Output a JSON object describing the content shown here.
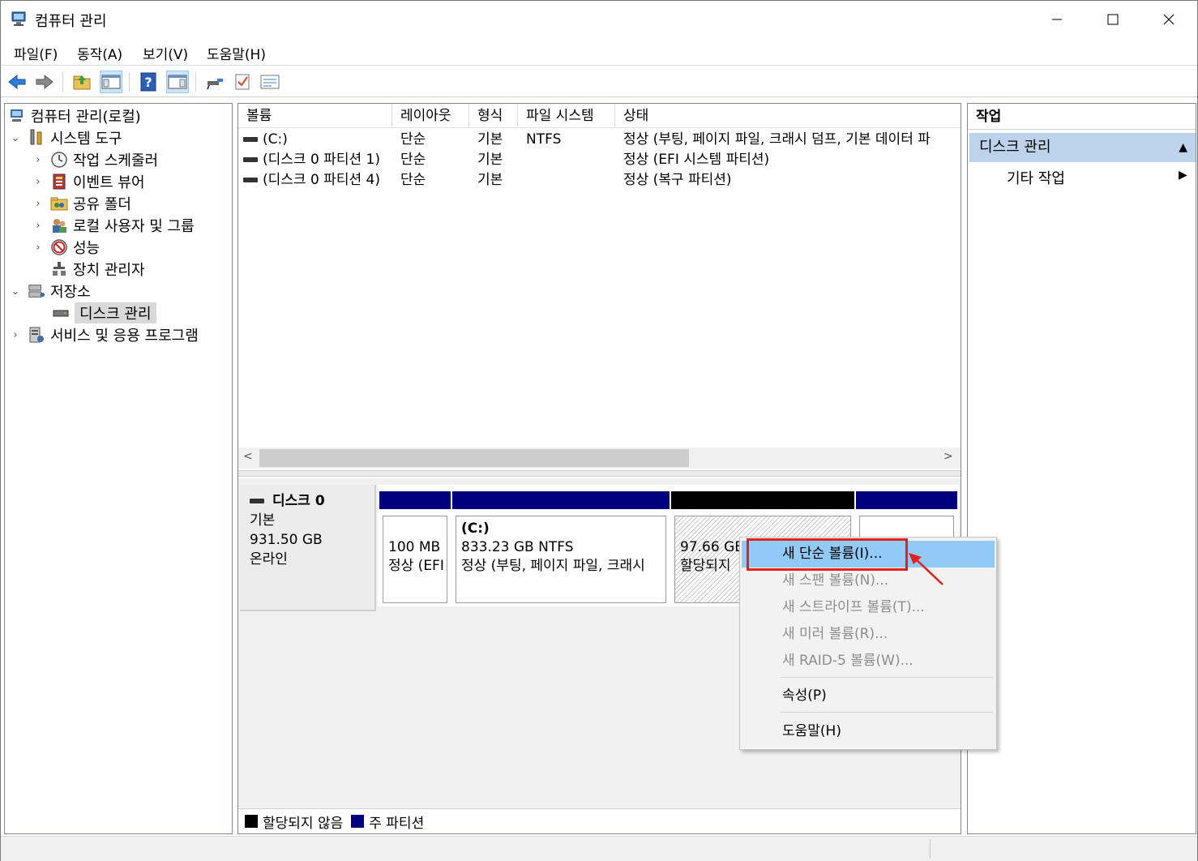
{
  "window": {
    "title": "컴퓨터 관리",
    "minimize": "—",
    "maximize": "☐",
    "close": "✕"
  },
  "menubar": {
    "items": [
      "파일(F)",
      "동작(A)",
      "보기(V)",
      "도움말(H)"
    ]
  },
  "toolbar": {
    "icons": [
      "back-icon",
      "forward-icon",
      "folder-up-icon",
      "show-hide-console-tree-icon",
      "help-icon",
      "show-hide-action-pane-icon",
      "connect-icon",
      "checklist-icon",
      "properties-icon"
    ]
  },
  "tree": {
    "root": "컴퓨터 관리(로컬)",
    "system_tools": "시스템 도구",
    "task_scheduler": "작업 스케줄러",
    "event_viewer": "이벤트 뷰어",
    "shared_folders": "공유 폴더",
    "local_users": "로컬 사용자 및 그룹",
    "performance": "성능",
    "device_manager": "장치 관리자",
    "storage": "저장소",
    "disk_management": "디스크 관리",
    "services": "서비스 및 응용 프로그램"
  },
  "volume_list": {
    "headers": [
      "볼륨",
      "레이아웃",
      "형식",
      "파일 시스템",
      "상태"
    ],
    "rows": [
      {
        "volume": "(C:)",
        "layout": "단순",
        "type": "기본",
        "fs": "NTFS",
        "status": "정상 (부팅, 페이지 파일, 크래시 덤프, 기본 데이터 파"
      },
      {
        "volume": "(디스크 0 파티션 1)",
        "layout": "단순",
        "type": "기본",
        "fs": "",
        "status": "정상 (EFI 시스템 파티션)"
      },
      {
        "volume": "(디스크 0 파티션 4)",
        "layout": "단순",
        "type": "기본",
        "fs": "",
        "status": "정상 (복구 파티션)"
      }
    ],
    "scroll_left": "<",
    "scroll_right": ">"
  },
  "disk": {
    "name": "디스크 0",
    "kind": "기본",
    "size": "931.50 GB",
    "state": "온라인",
    "partitions": [
      {
        "name": "",
        "line1": "100 MB",
        "line2": "정상 (EFI"
      },
      {
        "name": "(C:)",
        "line1": "833.23 GB NTFS",
        "line2": "정상 (부팅, 페이지 파일, 크래시"
      },
      {
        "name": "",
        "line1": "97.66 GB",
        "line2": "할당되지"
      },
      {
        "name": "",
        "line1": "",
        "line2": ""
      }
    ]
  },
  "legend": {
    "unallocated": "할당되지 않음",
    "primary": "주 파티션",
    "unallocated_color": "#000000",
    "primary_color": "#00007f"
  },
  "actions": {
    "title": "작업",
    "section": "디스크 관리",
    "section_arrow": "▲",
    "more": "기타 작업",
    "more_arrow": "▶"
  },
  "context_menu": {
    "new_simple": "새 단순 볼륨(I)...",
    "new_spanned": "새 스팬 볼륨(N)...",
    "new_striped": "새 스트라이프 볼륨(T)...",
    "new_mirror": "새 미러 볼륨(R)...",
    "new_raid5": "새 RAID-5 볼륨(W)...",
    "properties": "속성(P)",
    "help": "도움말(H)"
  },
  "colors": {
    "primary_partition": "#00007f",
    "unallocated": "#000000",
    "highlight": "#e2201e",
    "menu_hover": "#91c9f7",
    "action_section": "#bcd3eb"
  }
}
